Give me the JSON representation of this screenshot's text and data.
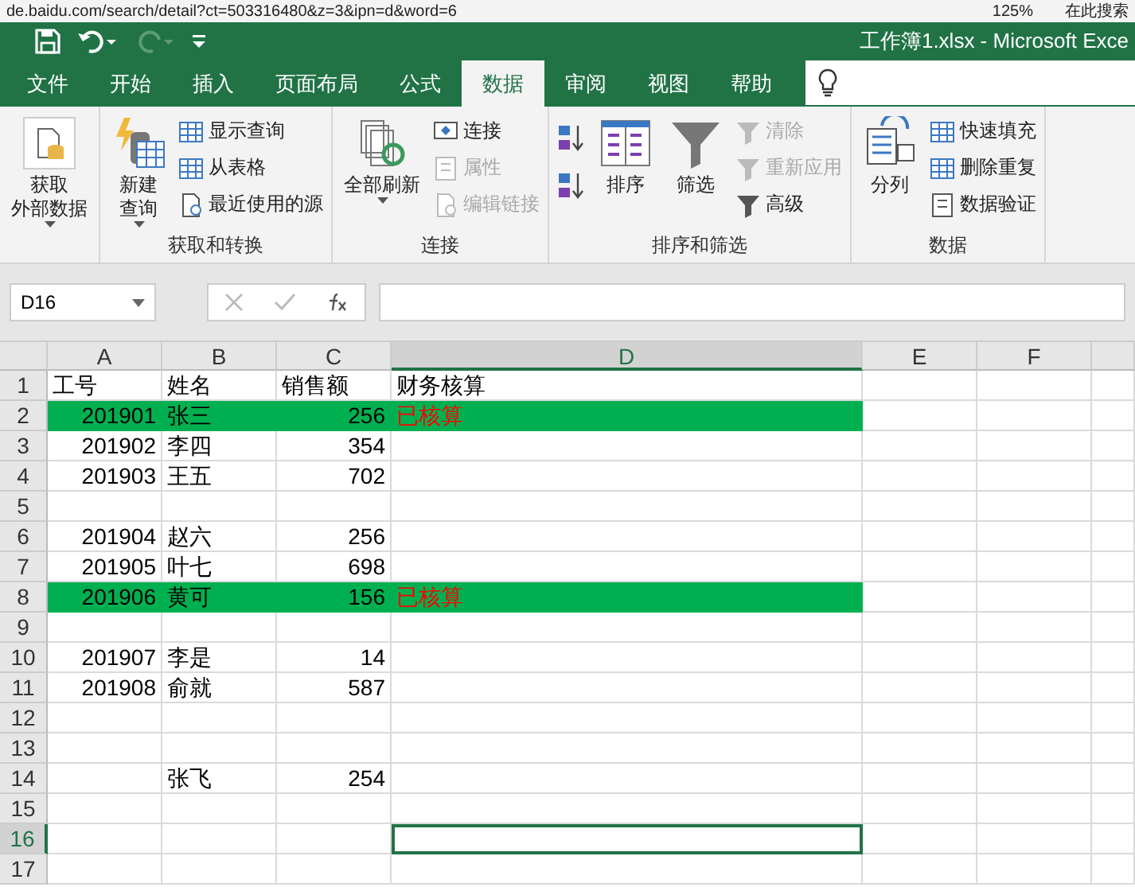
{
  "browser_strip": {
    "url": "de.baidu.com/search/detail?ct=503316480&z=3&ipn=d&word=6",
    "zoom": "125%",
    "search": "在此搜索"
  },
  "window": {
    "title": "工作簿1.xlsx  -  Microsoft Exce"
  },
  "tabs": [
    {
      "label": "文件",
      "selected": false
    },
    {
      "label": "开始",
      "selected": false
    },
    {
      "label": "插入",
      "selected": false
    },
    {
      "label": "页面布局",
      "selected": false
    },
    {
      "label": "公式",
      "selected": false
    },
    {
      "label": "数据",
      "selected": true
    },
    {
      "label": "审阅",
      "selected": false
    },
    {
      "label": "视图",
      "selected": false
    },
    {
      "label": "帮助",
      "selected": false
    }
  ],
  "ribbon": {
    "groups": [
      {
        "items": [
          {
            "kind": "large",
            "lines": [
              "获取",
              "外部数据"
            ],
            "dropdown": true
          }
        ]
      },
      {
        "label": "获取和转换",
        "items": [
          {
            "kind": "large",
            "lines": [
              "新建",
              "查询"
            ],
            "dropdown": true
          },
          {
            "kind": "stack",
            "entries": [
              {
                "label": "显示查询",
                "disabled": false
              },
              {
                "label": "从表格",
                "disabled": false
              },
              {
                "label": "最近使用的源",
                "disabled": false
              }
            ]
          }
        ]
      },
      {
        "label": "连接",
        "items": [
          {
            "kind": "large",
            "lines": [
              "全部刷新"
            ],
            "dropdown": true
          },
          {
            "kind": "stack",
            "entries": [
              {
                "label": "连接",
                "disabled": false
              },
              {
                "label": "属性",
                "disabled": true
              },
              {
                "label": "编辑链接",
                "disabled": true
              }
            ]
          }
        ]
      },
      {
        "label": "排序和筛选",
        "items": [
          {
            "kind": "sortpair"
          },
          {
            "kind": "large",
            "lines": [
              "排序"
            ],
            "dropdown": false
          },
          {
            "kind": "large",
            "lines": [
              "筛选"
            ],
            "dropdown": false
          },
          {
            "kind": "stack",
            "entries": [
              {
                "label": "清除",
                "disabled": true
              },
              {
                "label": "重新应用",
                "disabled": true
              },
              {
                "label": "高级",
                "disabled": false
              }
            ]
          }
        ]
      },
      {
        "label": "数据",
        "items": [
          {
            "kind": "large",
            "lines": [
              "分列"
            ],
            "dropdown": false
          },
          {
            "kind": "stack",
            "entries": [
              {
                "label": "快速填充",
                "disabled": false
              },
              {
                "label": "删除重复",
                "disabled": false
              },
              {
                "label": "数据验证",
                "disabled": false
              }
            ]
          }
        ]
      }
    ]
  },
  "name_box": "D16",
  "sheet": {
    "columns": [
      {
        "label": "A",
        "selected": false
      },
      {
        "label": "B",
        "selected": false
      },
      {
        "label": "C",
        "selected": false
      },
      {
        "label": "D",
        "selected": true
      },
      {
        "label": "E",
        "selected": false
      },
      {
        "label": "F",
        "selected": false
      }
    ],
    "rows": [
      {
        "num": "1",
        "selected": false,
        "highlighted": false,
        "cells": [
          {
            "text": "工号",
            "kind": "text"
          },
          {
            "text": "姓名",
            "kind": "text"
          },
          {
            "text": "销售额",
            "kind": "text"
          },
          {
            "text": "财务核算",
            "kind": "text"
          }
        ]
      },
      {
        "num": "2",
        "selected": false,
        "highlighted": true,
        "cells": [
          {
            "text": "201901",
            "kind": "number"
          },
          {
            "text": "张三",
            "kind": "text"
          },
          {
            "text": "256",
            "kind": "number"
          },
          {
            "text": "已核算",
            "kind": "text",
            "color": "#ff0000"
          }
        ]
      },
      {
        "num": "3",
        "selected": false,
        "highlighted": false,
        "cells": [
          {
            "text": "201902",
            "kind": "number"
          },
          {
            "text": "李四",
            "kind": "text"
          },
          {
            "text": "354",
            "kind": "number"
          }
        ]
      },
      {
        "num": "4",
        "selected": false,
        "highlighted": false,
        "cells": [
          {
            "text": "201903",
            "kind": "number"
          },
          {
            "text": "王五",
            "kind": "text"
          },
          {
            "text": "702",
            "kind": "number"
          }
        ]
      },
      {
        "num": "5",
        "selected": false,
        "highlighted": false,
        "cells": []
      },
      {
        "num": "6",
        "selected": false,
        "highlighted": false,
        "cells": [
          {
            "text": "201904",
            "kind": "number"
          },
          {
            "text": "赵六",
            "kind": "text"
          },
          {
            "text": "256",
            "kind": "number"
          }
        ]
      },
      {
        "num": "7",
        "selected": false,
        "highlighted": false,
        "cells": [
          {
            "text": "201905",
            "kind": "number"
          },
          {
            "text": "叶七",
            "kind": "text"
          },
          {
            "text": "698",
            "kind": "number"
          }
        ]
      },
      {
        "num": "8",
        "selected": false,
        "highlighted": true,
        "cells": [
          {
            "text": "201906",
            "kind": "number"
          },
          {
            "text": "黄可",
            "kind": "text"
          },
          {
            "text": "156",
            "kind": "number"
          },
          {
            "text": "已核算",
            "kind": "text",
            "color": "#ff0000"
          }
        ]
      },
      {
        "num": "9",
        "selected": false,
        "highlighted": false,
        "cells": []
      },
      {
        "num": "10",
        "selected": false,
        "highlighted": false,
        "cells": [
          {
            "text": "201907",
            "kind": "number"
          },
          {
            "text": "李是",
            "kind": "text"
          },
          {
            "text": "14",
            "kind": "number"
          }
        ]
      },
      {
        "num": "11",
        "selected": false,
        "highlighted": false,
        "cells": [
          {
            "text": "201908",
            "kind": "number"
          },
          {
            "text": "俞就",
            "kind": "text"
          },
          {
            "text": "587",
            "kind": "number"
          }
        ]
      },
      {
        "num": "12",
        "selected": false,
        "highlighted": false,
        "cells": []
      },
      {
        "num": "13",
        "selected": false,
        "highlighted": false,
        "cells": []
      },
      {
        "num": "14",
        "selected": false,
        "highlighted": false,
        "cells": [
          null,
          {
            "text": "张飞",
            "kind": "text"
          },
          {
            "text": "254",
            "kind": "number"
          }
        ]
      },
      {
        "num": "15",
        "selected": false,
        "highlighted": false,
        "cells": []
      },
      {
        "num": "16",
        "selected": true,
        "highlighted": false,
        "cells": []
      },
      {
        "num": "17",
        "selected": false,
        "highlighted": false,
        "cells": []
      }
    ]
  }
}
